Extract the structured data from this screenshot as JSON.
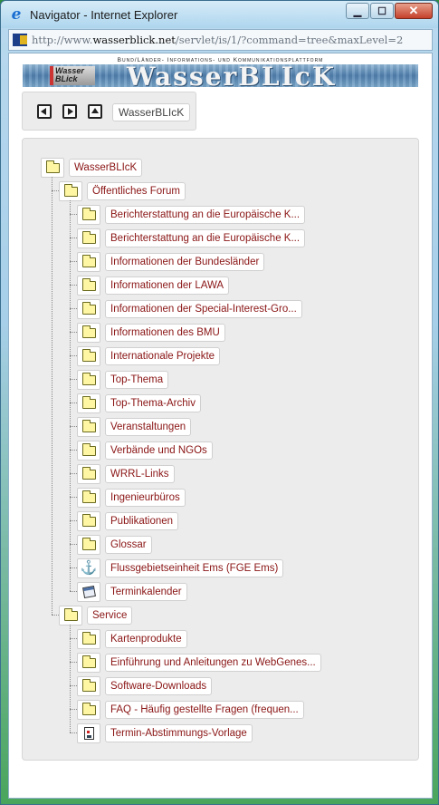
{
  "window": {
    "title": "Navigator - Internet Explorer",
    "minimize_label": "▁",
    "maximize_label": "☐",
    "close_label": "✕"
  },
  "address": {
    "url_prefix": "http://www.",
    "url_domain": "wasserblick.net",
    "url_path": "/servlet/is/1/?command=tree&maxLevel=2"
  },
  "banner": {
    "subtitle": "Bund/Länder- Informations- und Kommunikationsplattform",
    "logo_text": "Wasser BLick",
    "title": "WasserBLIcK"
  },
  "nav": {
    "current_label": "WasserBLIcK"
  },
  "tree": {
    "root": {
      "label": "WasserBLIcK",
      "icon": "folder-icon"
    },
    "groups": [
      {
        "label": "Öffentliches Forum",
        "icon": "folder-icon",
        "children": [
          {
            "label": "Berichterstattung an die Europäische K...",
            "icon": "folder-icon"
          },
          {
            "label": "Berichterstattung an die Europäische K...",
            "icon": "folder-icon"
          },
          {
            "label": "Informationen der Bundesländer",
            "icon": "folder-icon"
          },
          {
            "label": "Informationen der LAWA",
            "icon": "folder-icon"
          },
          {
            "label": "Informationen der Special-Interest-Gro...",
            "icon": "folder-icon"
          },
          {
            "label": "Informationen des BMU",
            "icon": "folder-icon"
          },
          {
            "label": "Internationale Projekte",
            "icon": "folder-icon"
          },
          {
            "label": "Top-Thema",
            "icon": "folder-icon"
          },
          {
            "label": "Top-Thema-Archiv",
            "icon": "folder-icon"
          },
          {
            "label": "Veranstaltungen",
            "icon": "folder-icon"
          },
          {
            "label": "Verbände und NGOs",
            "icon": "folder-icon"
          },
          {
            "label": "WRRL-Links",
            "icon": "folder-icon"
          },
          {
            "label": "Ingenieurbüros",
            "icon": "folder-icon"
          },
          {
            "label": "Publikationen",
            "icon": "folder-icon"
          },
          {
            "label": "Glossar",
            "icon": "folder-icon"
          },
          {
            "label": "Flussgebietseinheit Ems (FGE Ems)",
            "icon": "anchor-icon"
          },
          {
            "label": "Terminkalender",
            "icon": "calendar-icon"
          }
        ]
      },
      {
        "label": "Service",
        "icon": "folder-icon",
        "children": [
          {
            "label": "Kartenprodukte",
            "icon": "folder-icon"
          },
          {
            "label": "Einführung und Anleitungen zu WebGenes...",
            "icon": "folder-icon"
          },
          {
            "label": "Software-Downloads",
            "icon": "folder-icon"
          },
          {
            "label": "FAQ - Häufig gestellte Fragen (frequen...",
            "icon": "folder-icon"
          },
          {
            "label": "Termin-Abstimmungs-Vorlage",
            "icon": "document-icon"
          }
        ]
      }
    ]
  },
  "colors": {
    "link": "#8a1414",
    "folder_fill": "#fff6a3",
    "panel_bg": "#ececec"
  }
}
